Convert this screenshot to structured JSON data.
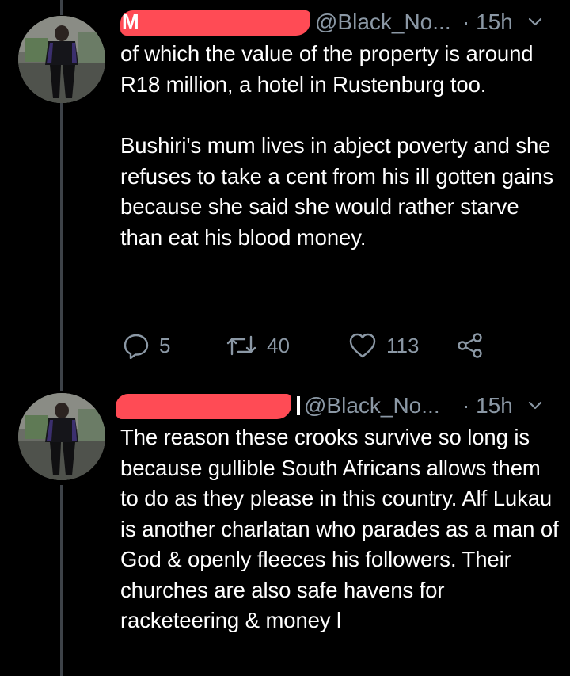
{
  "colors": {
    "background": "#000000",
    "text": "#ffffff",
    "secondary": "#8b98a5",
    "thread_line": "#3d4248",
    "redaction": "#ff4b55"
  },
  "tweets": [
    {
      "name_fragment": "M",
      "handle": "@Black_No...",
      "time": "· 15h",
      "paragraphs": [
        "of which the value of the property is around R18 million, a hotel in Rustenburg too.",
        "Bushiri's mum lives in abject poverty and she refuses to take a cent from his ill gotten gains because she said she would rather starve than eat his blood money."
      ],
      "replies": "5",
      "retweets": "40",
      "likes": "113",
      "icons": [
        "reply-icon",
        "retweet-icon",
        "heart-icon",
        "share-icon",
        "chevron-down-icon"
      ]
    },
    {
      "handle": "@Black_No...",
      "time": "· 15h",
      "paragraphs": [
        "The reason these crooks survive so long is because gullible South Africans allows them to do as they please in this country. Alf Lukau is another charlatan who parades as a man of God & openly fleeces his followers. Their churches are also safe havens for racketeering & money l"
      ]
    }
  ]
}
